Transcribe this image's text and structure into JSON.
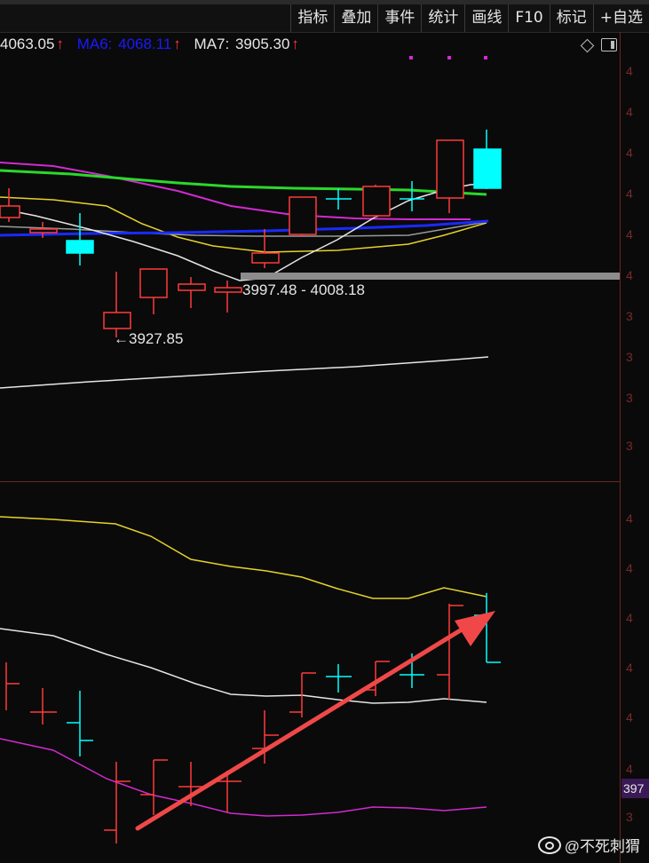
{
  "toolbar": {
    "items": [
      "指标",
      "叠加",
      "事件",
      "统计",
      "画线",
      "F10",
      "标记",
      "+自选"
    ]
  },
  "ma_row": {
    "first_value": "4063.05",
    "ma6_label": "MA6:",
    "ma6_value": "4068.11",
    "ma7_label": "MA7:",
    "ma7_value": "3905.30",
    "arrow": "↑"
  },
  "annotations": {
    "range": "3997.48 - 4008.18",
    "low": "←3927.85"
  },
  "price_tag": "397",
  "watermark": "@不死刺猬",
  "colors": {
    "up": "#ff3b3b",
    "down": "#00ffff",
    "ma_yellow": "#e6d22a",
    "ma_green": "#2bd82b",
    "ma_magenta": "#d12ad1",
    "ma_blue": "#1a2aff",
    "ma_white": "#e6e6e6",
    "ma6": "#1a1aff",
    "arrow": "#f04848"
  }
}
